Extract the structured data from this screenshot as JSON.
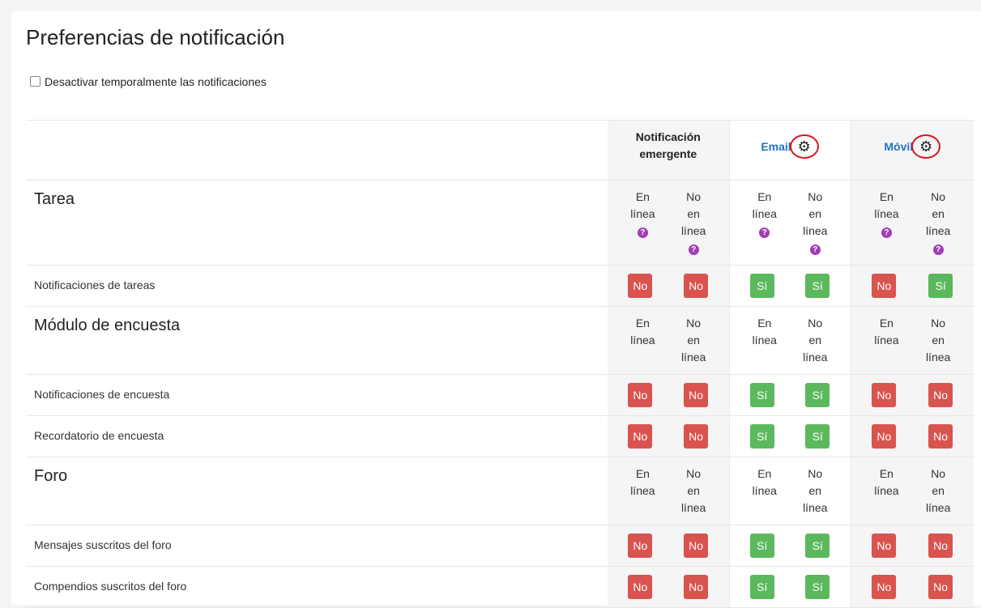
{
  "page": {
    "title": "Preferencias de notificación",
    "disable_label": "Desactivar temporalmente las notificaciones"
  },
  "processors": [
    {
      "label": "Notificación emergente",
      "link": false
    },
    {
      "label": "Email",
      "link": true,
      "icon": "gear-icon"
    },
    {
      "label": "Móvil",
      "link": true,
      "icon": "gear-icon"
    }
  ],
  "states": {
    "online": "En línea",
    "offline": "No en línea",
    "online_lines": [
      "En",
      "línea"
    ],
    "offline_lines": [
      "No",
      "en",
      "línea"
    ]
  },
  "buttons": {
    "no": "No",
    "yes": "Sí"
  },
  "sections": [
    {
      "title": "Tarea",
      "settings": [
        {
          "name": "Notificaciones de tareas",
          "values": [
            "No",
            "No",
            "Sí",
            "Sí",
            "No",
            "Sí"
          ]
        }
      ]
    },
    {
      "title": "Módulo de encuesta",
      "settings": [
        {
          "name": "Notificaciones de encuesta",
          "values": [
            "No",
            "No",
            "Sí",
            "Sí",
            "No",
            "No"
          ]
        },
        {
          "name": "Recordatorio de encuesta",
          "values": [
            "No",
            "No",
            "Sí",
            "Sí",
            "No",
            "No"
          ]
        }
      ]
    },
    {
      "title": "Foro",
      "settings": [
        {
          "name": "Mensajes suscritos del foro",
          "values": [
            "No",
            "No",
            "Sí",
            "Sí",
            "No",
            "No"
          ]
        },
        {
          "name": "Compendios suscritos del foro",
          "values": [
            "No",
            "No",
            "Sí",
            "Sí",
            "No",
            "No"
          ]
        }
      ]
    }
  ],
  "colors": {
    "no": "#d9534f",
    "yes": "#5cb85c",
    "link": "#1f74c7",
    "help": "#a33bb8",
    "highlight": "#d8151d"
  }
}
